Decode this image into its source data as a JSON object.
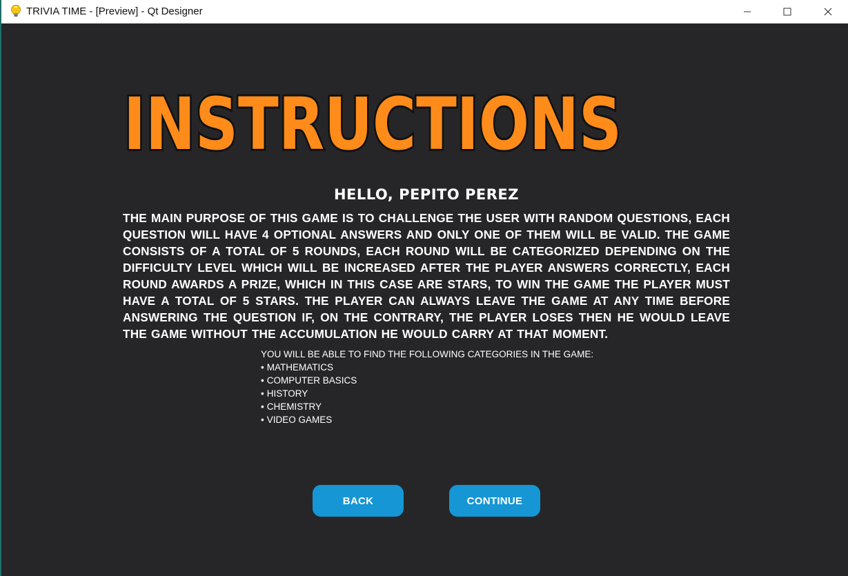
{
  "window": {
    "title": "TRIVIA TIME - [Preview] - Qt Designer",
    "icon": "lightbulb-icon",
    "controls": {
      "minimize": "minimize-icon",
      "maximize": "maximize-icon",
      "close": "close-icon"
    }
  },
  "colors": {
    "background": "#262628",
    "heading_fill": "#ff8c1a",
    "heading_outline": "#111111",
    "button": "#1696d4",
    "text": "#ffffff"
  },
  "screen": {
    "heading": "INSTRUCTIONS",
    "greeting": "HELLO, PEPITO PEREZ",
    "description": "THE MAIN PURPOSE OF THIS GAME IS TO CHALLENGE THE USER WITH RANDOM QUESTIONS, EACH QUESTION WILL HAVE 4 OPTIONAL ANSWERS AND ONLY ONE OF THEM WILL BE VALID. THE GAME CONSISTS OF A TOTAL OF 5 ROUNDS, EACH ROUND WILL BE CATEGORIZED DEPENDING ON THE DIFFICULTY LEVEL WHICH WILL BE INCREASED AFTER THE PLAYER ANSWERS CORRECTLY, EACH ROUND AWARDS A PRIZE, WHICH IN THIS CASE ARE STARS, TO WIN THE GAME THE PLAYER MUST HAVE A TOTAL OF 5 STARS. THE PLAYER CAN ALWAYS LEAVE THE GAME AT ANY TIME BEFORE ANSWERING THE QUESTION IF, ON THE CONTRARY, THE PLAYER LOSES THEN HE WOULD LEAVE THE GAME WITHOUT THE ACCUMULATION HE WOULD CARRY AT THAT MOMENT.",
    "categories_intro": "YOU WILL BE ABLE TO FIND THE FOLLOWING CATEGORIES IN THE GAME:",
    "categories": [
      "MATHEMATICS",
      "COMPUTER BASICS",
      "HISTORY",
      "CHEMISTRY",
      "VIDEO GAMES"
    ],
    "back_label": "BACK",
    "continue_label": "CONTINUE"
  }
}
